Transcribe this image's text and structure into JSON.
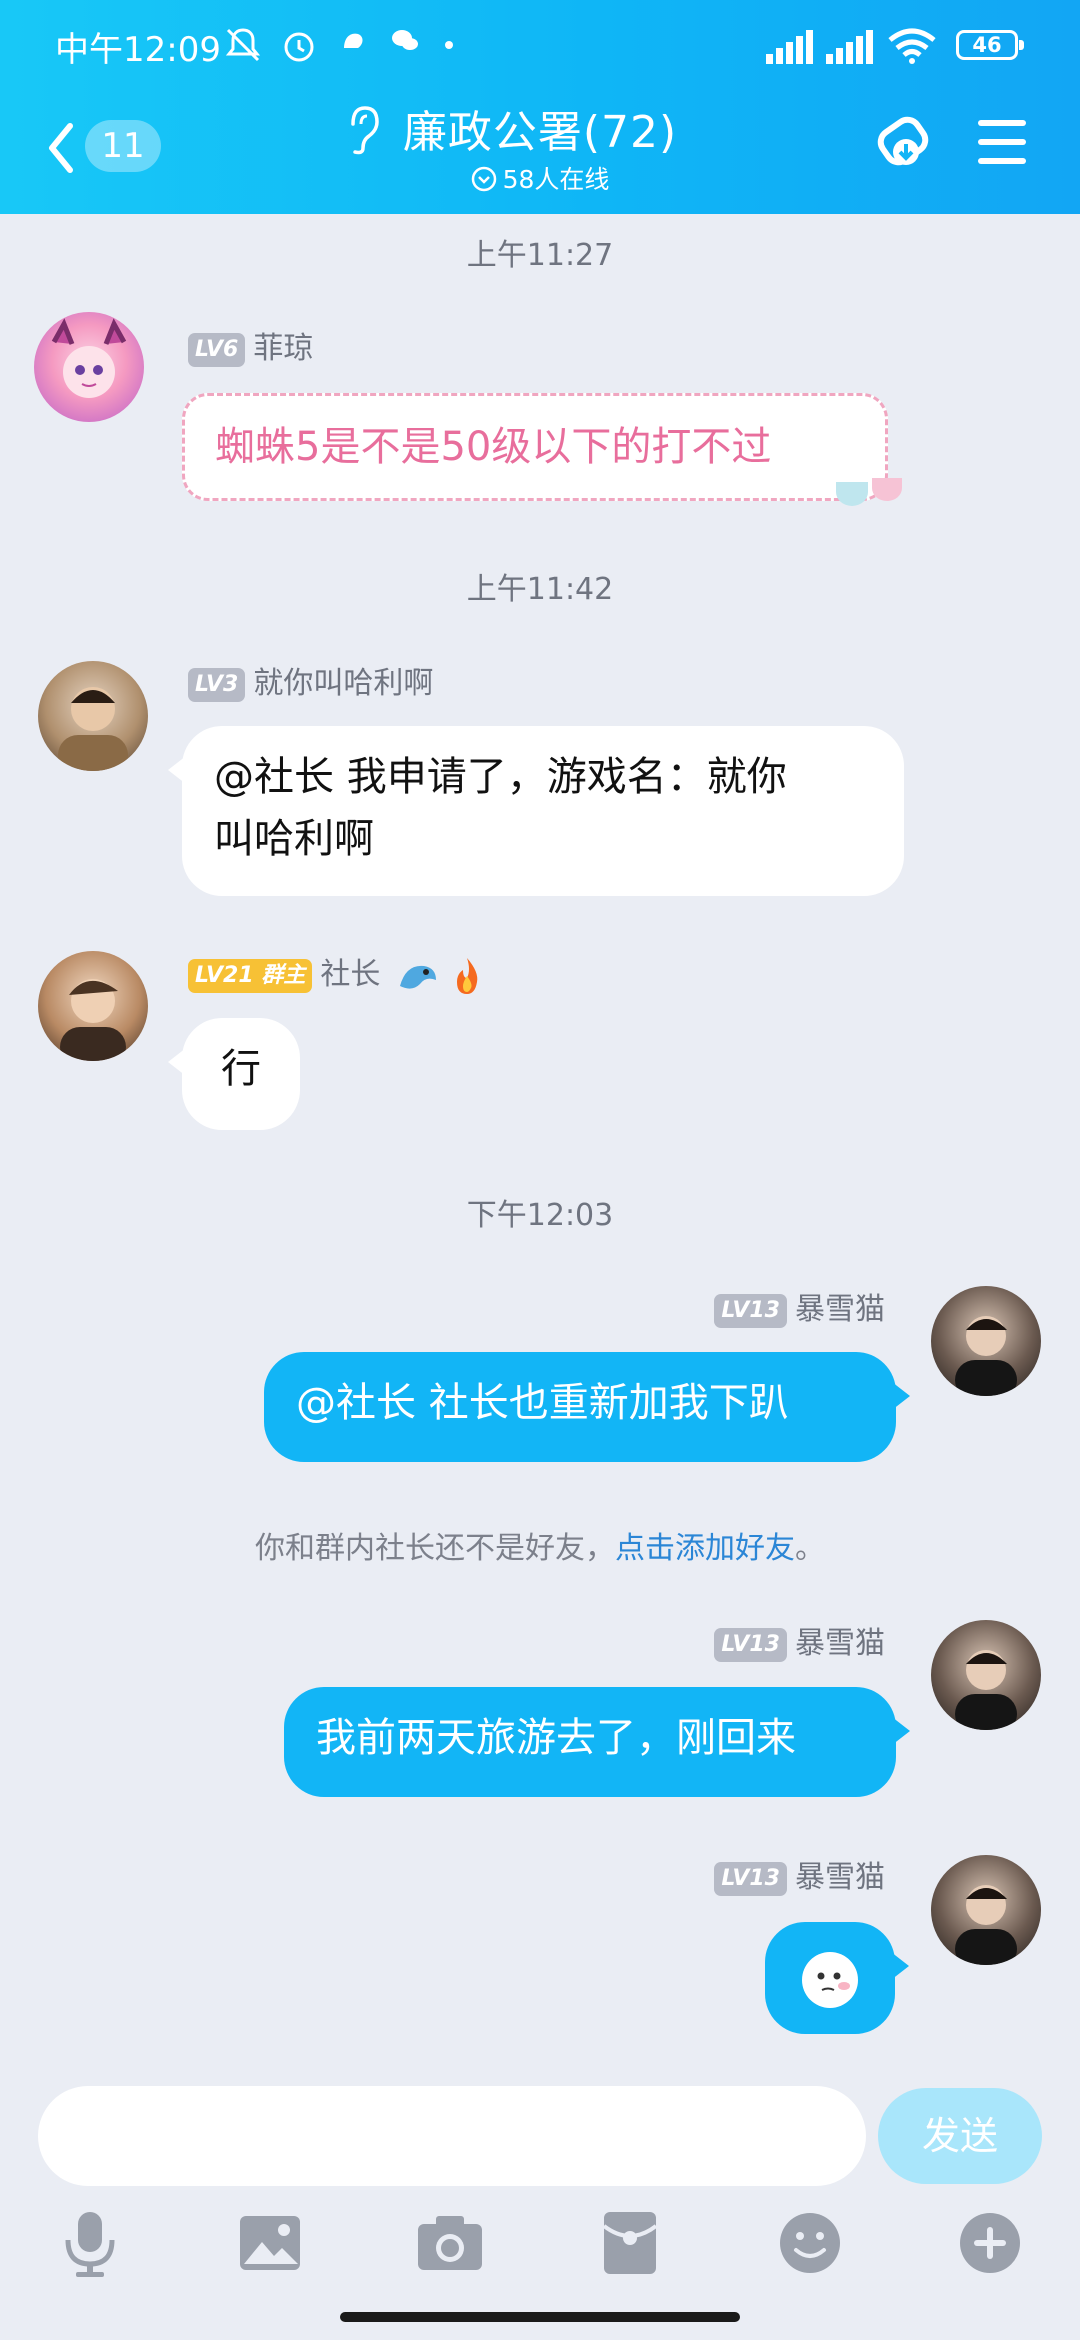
{
  "status_bar": {
    "time": "中午12:09",
    "battery": "46"
  },
  "header": {
    "back_count": "11",
    "title": "廉政公署(72)",
    "online": "58人在线"
  },
  "messages": [
    {
      "timestamp": "上午11:27"
    },
    {
      "level": "LV6",
      "name": "菲琼",
      "text": "蜘蛛5是不是50级以下的打不过"
    },
    {
      "timestamp": "上午11:42"
    },
    {
      "level": "LV3",
      "name": "就你叫哈利啊",
      "text_line1": "@社长 我申请了，游戏名：就你",
      "text_line2": "叫哈利啊"
    },
    {
      "level": "LV21",
      "role": "群主",
      "name": "社长",
      "text": "行"
    },
    {
      "timestamp": "下午12:03"
    },
    {
      "level": "LV13",
      "name": "暴雪猫",
      "text": "@社长 社长也重新加我下趴"
    },
    {
      "system_prefix": "你和群内社长还不是好友，",
      "system_link": "点击添加好友",
      "system_suffix": "。"
    },
    {
      "level": "LV13",
      "name": "暴雪猫",
      "text": "我前两天旅游去了，刚回来"
    },
    {
      "level": "LV13",
      "name": "暴雪猫",
      "sticker": "emoji-face"
    }
  ],
  "composer": {
    "send_label": "发送"
  },
  "toolbar_icons": [
    "microphone-icon",
    "image-icon",
    "camera-icon",
    "red-packet-icon",
    "emoji-icon",
    "plus-icon"
  ],
  "colors": {
    "accent": "#12b5f6",
    "pink_text": "#e86e9c",
    "gold_badge": "#f7c135"
  }
}
